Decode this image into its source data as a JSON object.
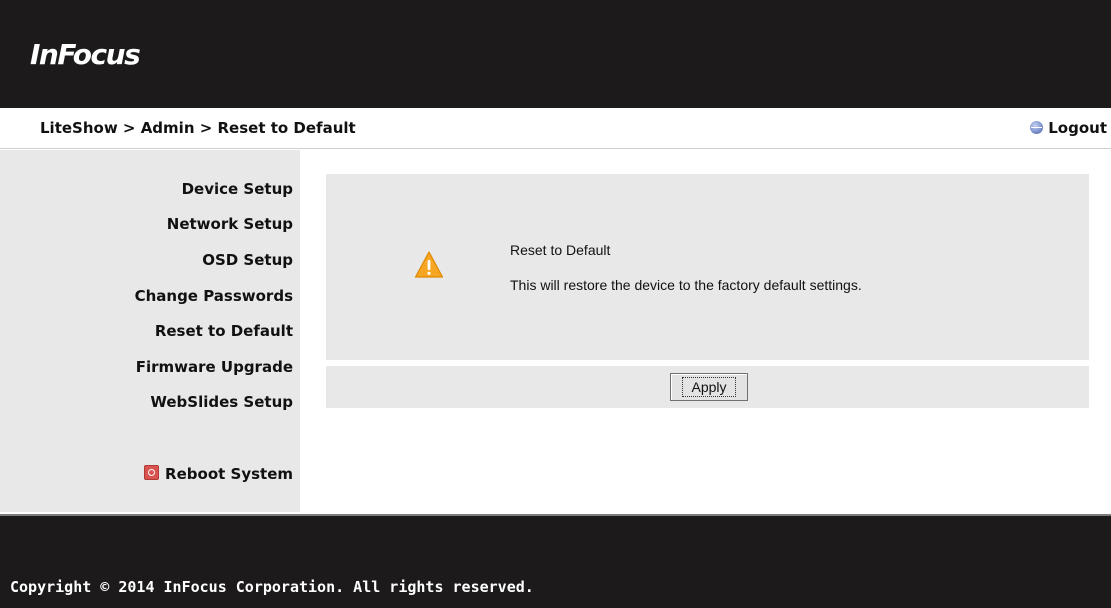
{
  "header": {
    "logo_text": "InFocus"
  },
  "breadcrumb": {
    "text": "LiteShow > Admin > Reset to Default"
  },
  "logout": {
    "label": "Logout"
  },
  "sidebar": {
    "items": [
      {
        "label": "Device Setup"
      },
      {
        "label": "Network Setup"
      },
      {
        "label": "OSD Setup"
      },
      {
        "label": "Change Passwords"
      },
      {
        "label": "Reset to Default"
      },
      {
        "label": "Firmware Upgrade"
      },
      {
        "label": "WebSlides Setup"
      }
    ],
    "reboot_label": "Reboot System"
  },
  "panel": {
    "title": "Reset to Default",
    "description": "This will restore the device to the factory default settings.",
    "icon": "warning-icon"
  },
  "actions": {
    "apply_label": "Apply"
  },
  "footer": {
    "copyright": "Copyright © 2014 InFocus Corporation. All rights reserved."
  },
  "colors": {
    "header_bg": "#1c1a1a",
    "sidebar_bg": "#e8e8e8",
    "panel_bg": "#e8e8e8",
    "warning": "#f39c12"
  }
}
